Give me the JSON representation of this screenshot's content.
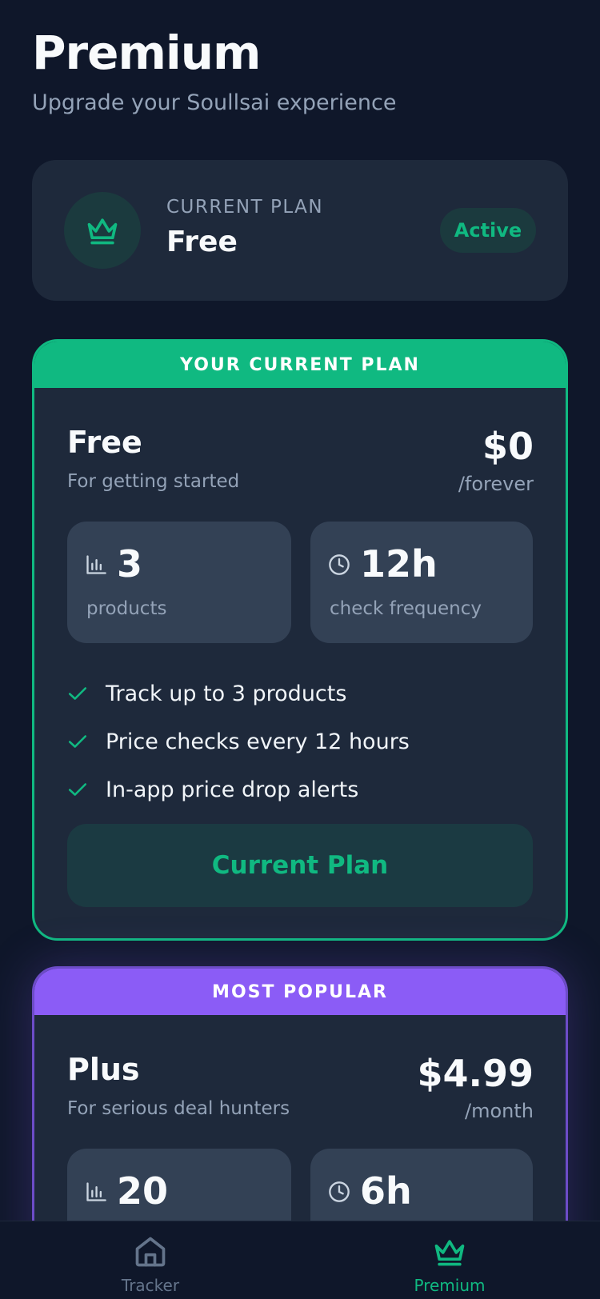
{
  "header": {
    "title": "Premium",
    "subtitle": "Upgrade your Soullsai experience"
  },
  "current_plan": {
    "label": "CURRENT PLAN",
    "name": "Free",
    "status": "Active",
    "icon": "crown-icon"
  },
  "plans": [
    {
      "ribbon": "YOUR CURRENT PLAN",
      "name": "Free",
      "description": "For getting started",
      "price": "$0",
      "period": "/forever",
      "stats": [
        {
          "icon": "bar-chart-icon",
          "value": "3",
          "label": "products"
        },
        {
          "icon": "clock-icon",
          "value": "12h",
          "label": "check frequency"
        }
      ],
      "features": [
        "Track up to 3 products",
        "Price checks every 12 hours",
        "In-app price drop alerts"
      ],
      "cta": "Current Plan",
      "accent": "#10b981"
    },
    {
      "ribbon": "MOST POPULAR",
      "name": "Plus",
      "description": "For serious deal hunters",
      "price": "$4.99",
      "period": "/month",
      "stats": [
        {
          "icon": "bar-chart-icon",
          "value": "20"
        },
        {
          "icon": "clock-icon",
          "value": "6h"
        }
      ],
      "accent": "#8b5cf6"
    }
  ],
  "nav": {
    "items": [
      {
        "label": "Tracker",
        "icon": "home-icon",
        "active": false
      },
      {
        "label": "Premium",
        "icon": "crown-icon",
        "active": true
      }
    ]
  },
  "colors": {
    "background": "#0f172a",
    "card": "#1e293b",
    "green": "#10b981",
    "purple": "#8b5cf6",
    "muted_text": "#94a3b8"
  }
}
